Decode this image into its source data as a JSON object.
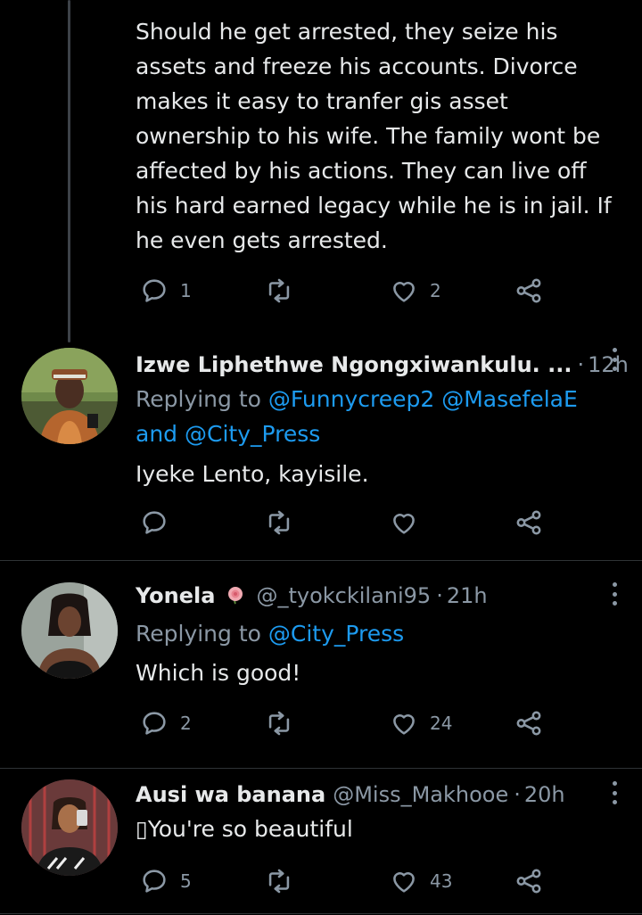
{
  "tweet1": {
    "text": "Should he get arrested, they seize his assets and freeze his accounts. Divorce makes it easy to tranfer gis asset ownership to his wife. The family wont be affected by his actions. They can live off his hard earned legacy while he is in jail. If he even gets arrested.",
    "replies": "1",
    "retweets": "",
    "likes": "2"
  },
  "tweet2": {
    "name": "Izwe Liphethwe Ngongxiwankulu. ...",
    "time": "12h",
    "replying_prefix": "Replying to",
    "mention1": "@Funnycreep2",
    "mention2": "@MasefelaE",
    "and_word": "and",
    "mention3": "@City_Press",
    "text": "Iyeke Lento, kayisile.",
    "replies": "",
    "retweets": "",
    "likes": ""
  },
  "tweet3": {
    "name": "Yonela",
    "handle": "@_tyokckilani95",
    "time": "21h",
    "replying_prefix": "Replying to",
    "mention1": "@City_Press",
    "text": "Which is good!",
    "replies": "2",
    "retweets": "",
    "likes": "24"
  },
  "tweet4": {
    "name": "Ausi wa banana",
    "handle": "@Miss_Makhooe",
    "time": "20h",
    "text": "▯You're so beautiful",
    "replies": "5",
    "retweets": "",
    "likes": "43"
  },
  "separator": "·",
  "colors": {
    "background": "#000000",
    "text": "#e7e9ea",
    "muted": "#8b98a5",
    "link": "#1d9bf0",
    "divider": "#2f3336"
  },
  "icons": [
    "reply-icon",
    "retweet-icon",
    "like-icon",
    "share-icon",
    "more-icon",
    "rose-emoji-icon"
  ]
}
